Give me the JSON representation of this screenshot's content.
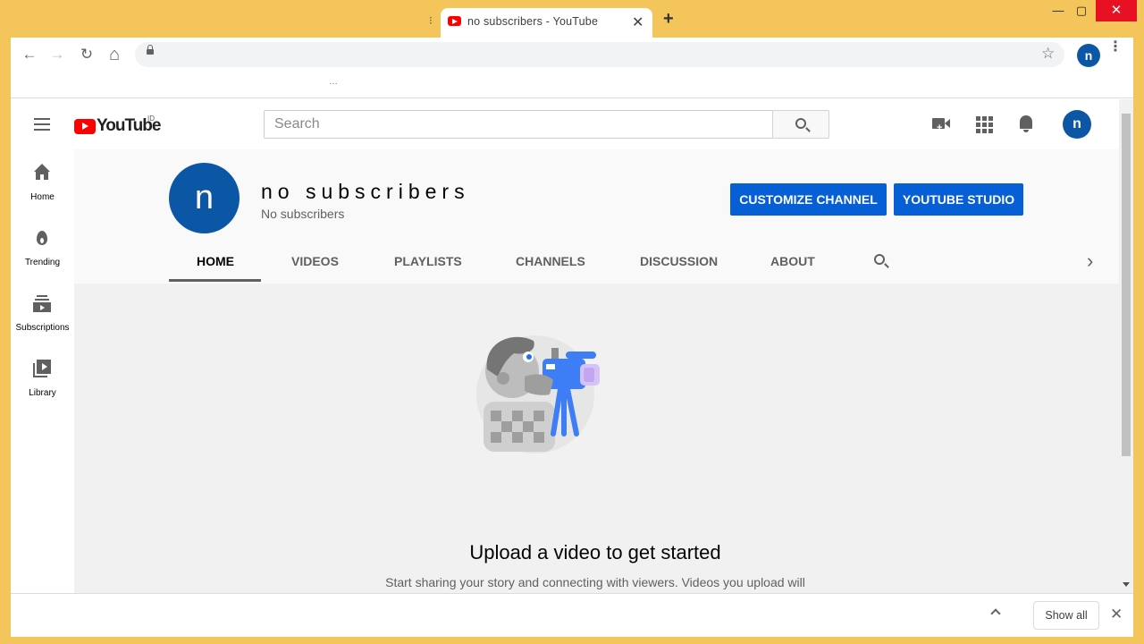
{
  "browser": {
    "tab_title": "no  subscribers - YouTube",
    "tab_close": "✕",
    "new_tab": "+",
    "tab_separator": "⁝",
    "bookmark_overflow": "…",
    "window_min": "—",
    "window_max": "▢",
    "window_close": "✕",
    "back": "←",
    "forward": "→",
    "reload": "↻",
    "home": "⌂",
    "star": "☆",
    "profile_initial": "n",
    "menu": "⋮"
  },
  "youtube": {
    "logo_text": "YouTube",
    "region": "ID",
    "search_placeholder": "Search",
    "user_initial": "n",
    "guide": [
      {
        "label": "Home",
        "icon": "home-icon"
      },
      {
        "label": "Trending",
        "icon": "fire-icon"
      },
      {
        "label": "Subscriptions",
        "icon": "subscriptions-icon"
      },
      {
        "label": "Library",
        "icon": "library-icon"
      }
    ],
    "channel": {
      "avatar_initial": "n",
      "name": "no  subscribers",
      "subscribers": "No subscribers",
      "customize_label": "CUSTOMIZE CHANNEL",
      "studio_label": "YOUTUBE STUDIO"
    },
    "tabs": [
      "HOME",
      "VIDEOS",
      "PLAYLISTS",
      "CHANNELS",
      "DISCUSSION",
      "ABOUT"
    ],
    "active_tab": "HOME",
    "tabs_next": "›",
    "empty_state": {
      "title": "Upload a video to get started",
      "description": "Start sharing your story and connecting with viewers. Videos you upload will"
    }
  },
  "download_bar": {
    "show_all_label": "Show all",
    "close": "✕"
  },
  "colors": {
    "window_frame": "#f3c55a",
    "brand_red": "#ff0000",
    "accent_blue": "#065fd4",
    "avatar_blue": "#0b57a6"
  }
}
